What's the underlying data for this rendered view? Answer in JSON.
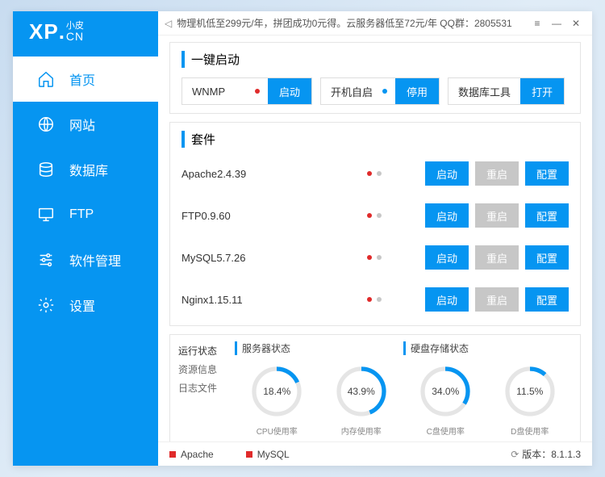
{
  "logo": {
    "xp": "XP",
    "dot": ".",
    "small": "小皮",
    "cn": "CN"
  },
  "sidebar": {
    "items": [
      {
        "label": "首页"
      },
      {
        "label": "网站"
      },
      {
        "label": "数据库"
      },
      {
        "label": "FTP"
      },
      {
        "label": "软件管理"
      },
      {
        "label": "设置"
      }
    ]
  },
  "titlebar": {
    "announce": "物理机低至299元/年，拼团成功0元得。云服务器低至72元/年  QQ群：2805531"
  },
  "quick": {
    "title": "一键启动",
    "groups": [
      {
        "text": "WNMP",
        "dot": "red",
        "btn": "启动"
      },
      {
        "text": "开机自启",
        "dot": "blue",
        "btn": "停用"
      },
      {
        "text": "数据库工具",
        "dot": "",
        "btn": "打开"
      }
    ]
  },
  "kits": {
    "title": "套件",
    "rows": [
      {
        "name": "Apache2.4.39",
        "actions": [
          "启动",
          "重启",
          "配置"
        ]
      },
      {
        "name": "FTP0.9.60",
        "actions": [
          "启动",
          "重启",
          "配置"
        ]
      },
      {
        "name": "MySQL5.7.26",
        "actions": [
          "启动",
          "重启",
          "配置"
        ]
      },
      {
        "name": "Nginx1.15.11",
        "actions": [
          "启动",
          "重启",
          "配置"
        ]
      }
    ]
  },
  "status": {
    "tabs": [
      "运行状态",
      "资源信息",
      "日志文件"
    ],
    "server_head": "服务器状态",
    "disk_head": "硬盘存储状态",
    "gauges": [
      {
        "val": "18.4%",
        "pct": 18.4,
        "label": "CPU使用率"
      },
      {
        "val": "43.9%",
        "pct": 43.9,
        "label": "内存使用率"
      },
      {
        "val": "34.0%",
        "pct": 34.0,
        "label": "C盘使用率"
      },
      {
        "val": "11.5%",
        "pct": 11.5,
        "label": "D盘使用率"
      }
    ]
  },
  "footer": {
    "items": [
      "Apache",
      "MySQL"
    ],
    "version_label": "版本：",
    "version": "8.1.1.3"
  }
}
